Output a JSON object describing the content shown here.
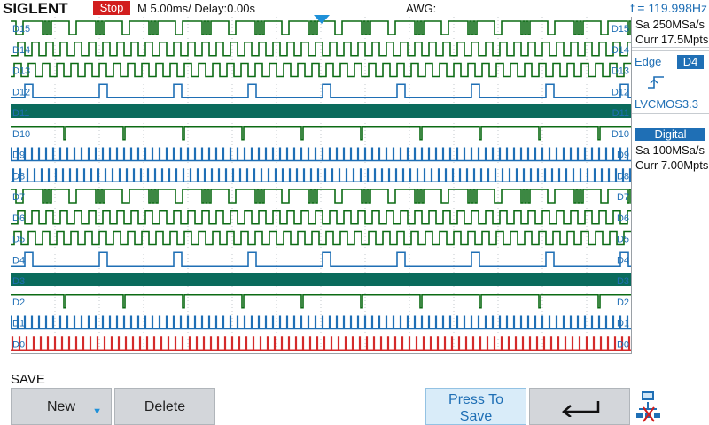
{
  "header": {
    "brand": "SIGLENT",
    "run_state": "Stop",
    "timebase": "M 5.00ms/ Delay:0.00s",
    "awg": "AWG:",
    "frequency": "f = 119.998Hz"
  },
  "channels": [
    {
      "label": "D15",
      "right_label": "D15",
      "kind": "burst",
      "color": "#0c6b14",
      "period": 60,
      "phase": 0
    },
    {
      "label": "D14",
      "right_label": "D14",
      "kind": "square",
      "color": "#0c6b14",
      "period": 16,
      "phase": 0
    },
    {
      "label": "D13",
      "right_label": "D13",
      "kind": "square",
      "color": "#0c6b14",
      "period": 16,
      "phase": 4
    },
    {
      "label": "D12",
      "right_label": "D12",
      "kind": "pulses",
      "color": "#1f6fb5",
      "period": 84,
      "phase": 100
    },
    {
      "label": "D11",
      "right_label": "D11",
      "kind": "solid",
      "color": "#0a6b5c",
      "period": 0,
      "phase": 0
    },
    {
      "label": "D10",
      "right_label": "D10",
      "kind": "negpulses",
      "color": "#0c6b14",
      "period": 67,
      "phase": 60
    },
    {
      "label": "D9",
      "right_label": "D9",
      "kind": "ticks",
      "color": "#1f6fb5",
      "period": 8,
      "phase": 0
    },
    {
      "label": "D8",
      "right_label": "D8",
      "kind": "ticks",
      "color": "#1f6fb5",
      "period": 8,
      "phase": 3
    },
    {
      "label": "D7",
      "right_label": "D7",
      "kind": "burst",
      "color": "#0c6b14",
      "period": 60,
      "phase": 0
    },
    {
      "label": "D6",
      "right_label": "D6",
      "kind": "square",
      "color": "#0c6b14",
      "period": 16,
      "phase": 0
    },
    {
      "label": "D5",
      "right_label": "D5",
      "kind": "square",
      "color": "#0c6b14",
      "period": 16,
      "phase": 4
    },
    {
      "label": "D4",
      "right_label": "D4",
      "kind": "pulses",
      "color": "#1f6fb5",
      "period": 84,
      "phase": 100
    },
    {
      "label": "D3",
      "right_label": "D3",
      "kind": "solid",
      "color": "#0a6b5c",
      "period": 0,
      "phase": 0
    },
    {
      "label": "D2",
      "right_label": "D2",
      "kind": "negpulses",
      "color": "#0c6b14",
      "period": 67,
      "phase": 60
    },
    {
      "label": "D1",
      "right_label": "D1",
      "kind": "ticks",
      "color": "#1f6fb5",
      "period": 8,
      "phase": 0
    },
    {
      "label": "D0",
      "right_label": "D0",
      "kind": "ticks",
      "color": "#d42a2a",
      "period": 8,
      "phase": 2
    }
  ],
  "right_panel": {
    "sample_rate": "Sa 250MSa/s",
    "memory_depth": "Curr 17.5Mpts",
    "trigger_type": "Edge",
    "trigger_source": "D4",
    "trigger_level": "LVCMOS3.3",
    "digital_title": "Digital",
    "digital_sample_rate": "Sa 100MSa/s",
    "digital_memory_depth": "Curr 7.00Mpts"
  },
  "menu": {
    "title": "SAVE",
    "new_label": "New",
    "delete_label": "Delete",
    "press_to_label": "Press To",
    "save_label": "Save"
  },
  "icons": {
    "down_arrow": "down-arrow-icon",
    "return": "return-arrow-icon",
    "network": "network-icon",
    "trigger_edge": "rising-edge-icon",
    "trigger_position": "trigger-marker-icon"
  },
  "colors": {
    "accent": "#1f6fb5",
    "run_state": "#d21e1e",
    "grid": "#c3c8cd",
    "green_trace": "#0c6b14",
    "blue_trace": "#1f6fb5",
    "teal_trace": "#0a6b5c",
    "red_trace": "#d42a2a"
  }
}
